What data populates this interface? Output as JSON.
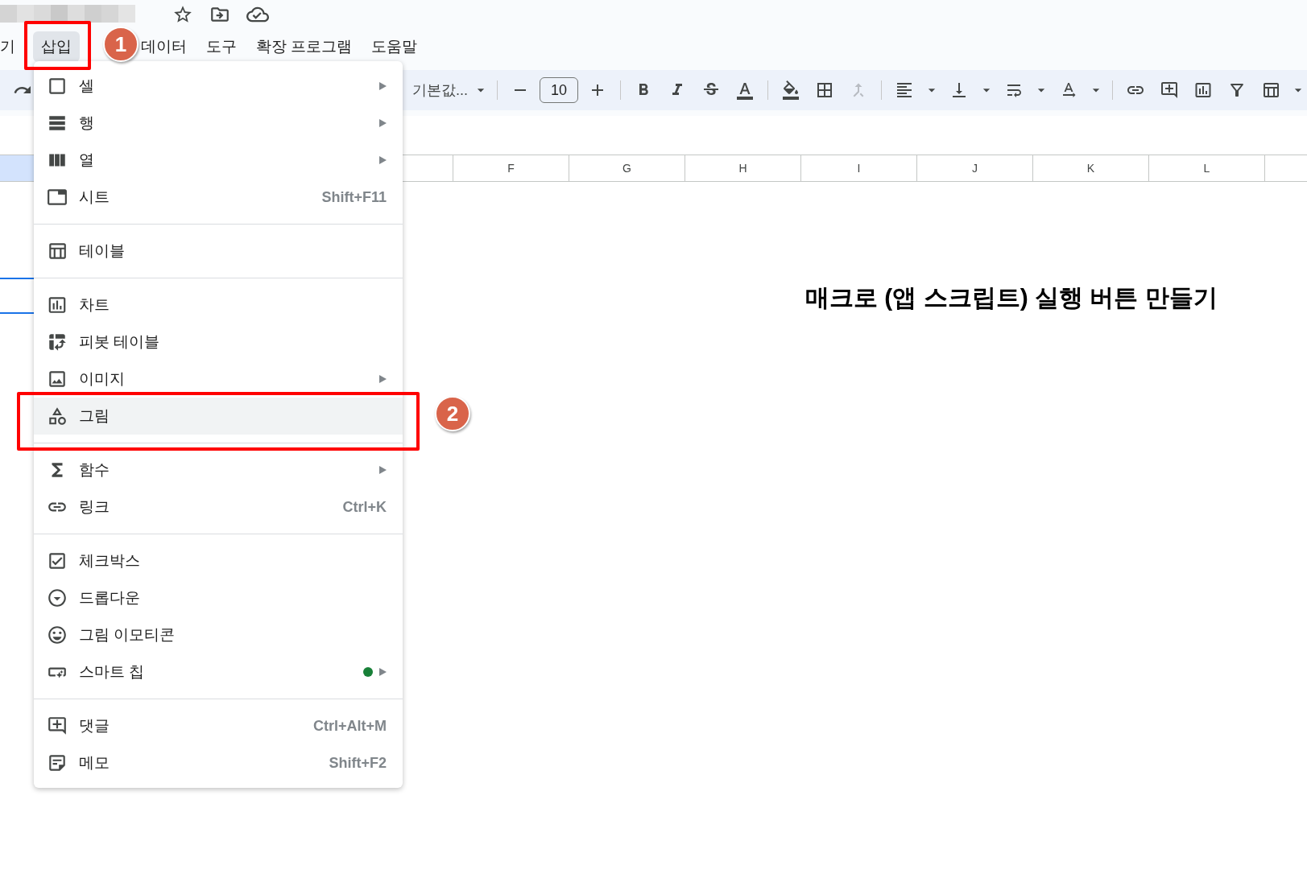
{
  "menu_bar": {
    "items": [
      {
        "label": "기",
        "selected": false
      },
      {
        "label": "삽입",
        "selected": true
      },
      {
        "label": "데이터",
        "selected": false
      },
      {
        "label": "도구",
        "selected": false
      },
      {
        "label": "확장 프로그램",
        "selected": false
      },
      {
        "label": "도움말",
        "selected": false
      }
    ]
  },
  "toolbar": {
    "font": "기본값...",
    "font_size": "10"
  },
  "columns": [
    "F",
    "G",
    "H",
    "I",
    "J",
    "K",
    "L"
  ],
  "sheet_title": "매크로 (앱 스크립트) 실행 버튼 만들기",
  "insert_menu": {
    "sections": [
      {
        "items": [
          {
            "label": "셀",
            "submenu": true,
            "highlighted": false,
            "new": false
          },
          {
            "label": "행",
            "submenu": true,
            "highlighted": false,
            "new": false
          },
          {
            "label": "열",
            "submenu": true,
            "highlighted": false,
            "new": false
          },
          {
            "label": "시트",
            "shortcut": "Shift+F11",
            "submenu": false,
            "highlighted": false,
            "new": false
          }
        ]
      },
      {
        "items": [
          {
            "label": "테이블",
            "submenu": false,
            "highlighted": false,
            "new": false
          }
        ]
      },
      {
        "items": [
          {
            "label": "차트",
            "submenu": false,
            "highlighted": false,
            "new": false
          },
          {
            "label": "피봇 테이블",
            "submenu": false,
            "highlighted": false,
            "new": false
          },
          {
            "label": "이미지",
            "submenu": true,
            "highlighted": false,
            "new": false
          },
          {
            "label": "그림",
            "submenu": false,
            "highlighted": true,
            "new": false
          }
        ]
      },
      {
        "items": [
          {
            "label": "함수",
            "submenu": true,
            "highlighted": false,
            "new": false
          },
          {
            "label": "링크",
            "shortcut": "Ctrl+K",
            "submenu": false,
            "highlighted": false,
            "new": false
          }
        ]
      },
      {
        "items": [
          {
            "label": "체크박스",
            "submenu": false,
            "highlighted": false,
            "new": false
          },
          {
            "label": "드롭다운",
            "submenu": false,
            "highlighted": false,
            "new": false
          },
          {
            "label": "그림 이모티콘",
            "submenu": false,
            "highlighted": false,
            "new": false
          },
          {
            "label": "스마트 칩",
            "submenu": true,
            "highlighted": false,
            "new": true
          }
        ]
      },
      {
        "items": [
          {
            "label": "댓글",
            "shortcut": "Ctrl+Alt+M",
            "submenu": false,
            "highlighted": false,
            "new": false
          },
          {
            "label": "메모",
            "shortcut": "Shift+F2",
            "submenu": false,
            "highlighted": false,
            "new": false
          }
        ]
      }
    ]
  },
  "annotations": [
    {
      "label": "1"
    },
    {
      "label": "2"
    }
  ]
}
